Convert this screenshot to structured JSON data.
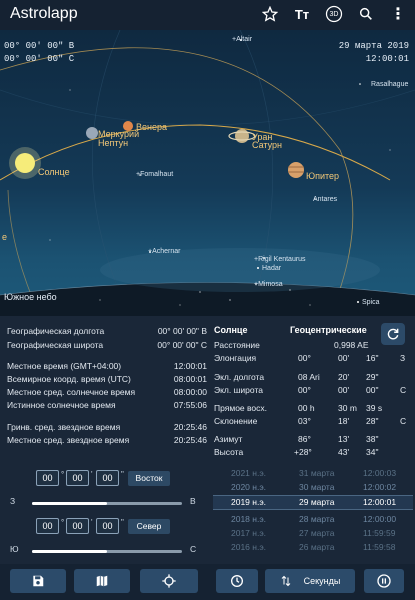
{
  "app": {
    "title": "Astrolapp"
  },
  "toolbar": {
    "icons": [
      "star-icon",
      "text-size-icon",
      "3d-icon",
      "search-icon",
      "more-vert-icon"
    ],
    "label_3d": "3D",
    "label_tt": "Tт",
    "label_more": "⋮"
  },
  "sky": {
    "coord_left_1": "00° 00' 00\" В",
    "coord_left_2": "00° 00' 00\" С",
    "date": "29 марта 2019",
    "time": "12:00:01",
    "south_label": "Южное небо",
    "objects": {
      "sun": "Солнце",
      "mercury": "Меркурий",
      "venus": "Венера",
      "neptune": "Нептун",
      "uranus": "Уран",
      "saturn": "Сатурн",
      "jupiter": "Юпитер"
    },
    "stars": {
      "altair": "+Altair",
      "rasalhague": "Rasalhague",
      "fomalhaut": "+Fomalhaut",
      "antares": "Antares",
      "achernar": "+Achernar",
      "rigil": "+Rigil Kentaurus",
      "hadar": "Hadar",
      "mimosa": "+Mimosa",
      "spica": "Spica",
      "e_mark": "е"
    }
  },
  "left_info": {
    "rows": [
      {
        "label": "Географическая долгота",
        "value": "00° 00' 00\" В"
      },
      {
        "label": "Географическая широта",
        "value": "00° 00' 00\" С"
      },
      {
        "label": "Местное время (GMT+04:00)",
        "value": "12:00:01"
      },
      {
        "label": "Всемирное коорд. время (UTC)",
        "value": "08:00:01"
      },
      {
        "label": "Местное сред. солнечное время",
        "value": "08:00:00"
      },
      {
        "label": "Истинное солнечное время",
        "value": "07:55:06"
      },
      {
        "label": "Гринв. сред. звездное время",
        "value": "20:25:46"
      },
      {
        "label": "Местное сред. звездное время",
        "value": "20:25:46"
      }
    ]
  },
  "right_info": {
    "object": "Солнце",
    "mode": "Геоцентрические",
    "distance_label": "Расстояние",
    "distance_value": "0,998 AE",
    "rows": [
      {
        "label": "Элонгация",
        "a": "00°",
        "b": "00'",
        "c": "16\"",
        "d": "З"
      },
      {
        "label": "Экл. долгота",
        "a": "08 Ari",
        "b": "20'",
        "c": "29\"",
        "d": ""
      },
      {
        "label": "Экл. широта",
        "a": "00°",
        "b": "00'",
        "c": "00\"",
        "d": "С"
      },
      {
        "label": "Прямое восх.",
        "a": "00 h",
        "b": "30 m",
        "c": "39 s",
        "d": ""
      },
      {
        "label": "Склонение",
        "a": "03°",
        "b": "18'",
        "c": "28\"",
        "d": "С"
      },
      {
        "label": "Азимут",
        "a": "86°",
        "b": "13'",
        "c": "38\"",
        "d": ""
      },
      {
        "label": "Высота",
        "a": "+28°",
        "b": "43'",
        "c": "34\"",
        "d": ""
      }
    ]
  },
  "controls": {
    "time1": {
      "h": "00",
      "m": "00",
      "s": "00",
      "dir": "Восток"
    },
    "slider1": {
      "left": "З",
      "right": "В",
      "level": 0.5
    },
    "time2": {
      "h": "00",
      "m": "00",
      "s": "00",
      "dir": "Север"
    },
    "slider2": {
      "left": "Ю",
      "right": "С",
      "level": 0.5
    },
    "deg_mark": "°",
    "min_mark": "'",
    "sec_mark": "\""
  },
  "picker": {
    "rows": [
      {
        "year": "2021 н.э.",
        "date": "31 марта",
        "time": "12:00:03"
      },
      {
        "year": "2020 н.э.",
        "date": "30 марта",
        "time": "12:00:02"
      },
      {
        "year": "2019 н.э.",
        "date": "29 марта",
        "time": "12:00:01"
      },
      {
        "year": "2018 н.э.",
        "date": "28 марта",
        "time": "12:00:00"
      },
      {
        "year": "2017 н.э.",
        "date": "27 марта",
        "time": "11:59:59"
      },
      {
        "year": "2016 н.э.",
        "date": "26 марта",
        "time": "11:59:58"
      }
    ],
    "selected_index": 2
  },
  "bottom": {
    "seconds_label": "Секунды"
  },
  "colors": {
    "accent": "#2c4b6a",
    "planet_label": "#f3c878",
    "background": "#1a2738"
  }
}
